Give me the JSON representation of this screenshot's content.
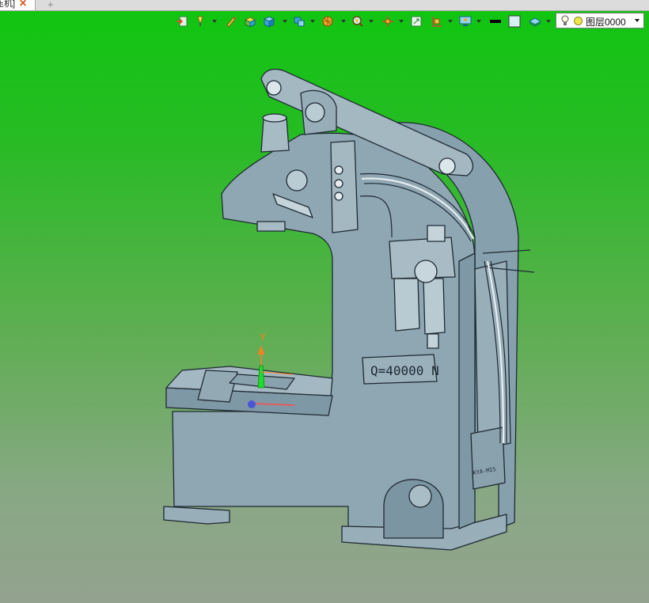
{
  "tab": {
    "label": "压机]",
    "close_glyph": "✕",
    "add_glyph": "+"
  },
  "toolbar": {
    "buttons": [
      {
        "name": "import-icon",
        "dropdown": false
      },
      {
        "name": "highlight-icon",
        "dropdown": true
      },
      {
        "name": "pencil-icon",
        "dropdown": false
      },
      {
        "name": "shaded-edges-icon",
        "dropdown": false
      },
      {
        "name": "cube-view-icon",
        "dropdown": true
      },
      {
        "name": "multi-view-icon",
        "dropdown": true
      },
      {
        "name": "render-mode-icon",
        "dropdown": true
      },
      {
        "name": "zoom-icon",
        "dropdown": true
      },
      {
        "name": "pan-icon",
        "dropdown": true
      },
      {
        "name": "zoom-extents-icon",
        "dropdown": false
      },
      {
        "name": "section-icon",
        "dropdown": true
      },
      {
        "name": "display-icon",
        "dropdown": true
      },
      {
        "name": "line-color-icon",
        "dropdown": false
      },
      {
        "name": "fill-color-icon",
        "dropdown": false
      },
      {
        "name": "layer-manager-icon",
        "dropdown": true
      }
    ],
    "colors": {
      "line_color": "#000000",
      "fill_color": "#d8eef5"
    }
  },
  "layer": {
    "current": "图层0000",
    "state_icon": "bulb-icon",
    "color_icon": "yellow-ball-icon",
    "color": "#f0e64a"
  },
  "viewport": {
    "background_top": "#0fc60f",
    "background_bottom": "#93a28f",
    "model_color": "#8fa7b3",
    "edge_color": "#1e2a33",
    "nameplate_text": "Q=40000 N",
    "side_label_text": "KYA-MIS",
    "axis_label": "Y"
  }
}
